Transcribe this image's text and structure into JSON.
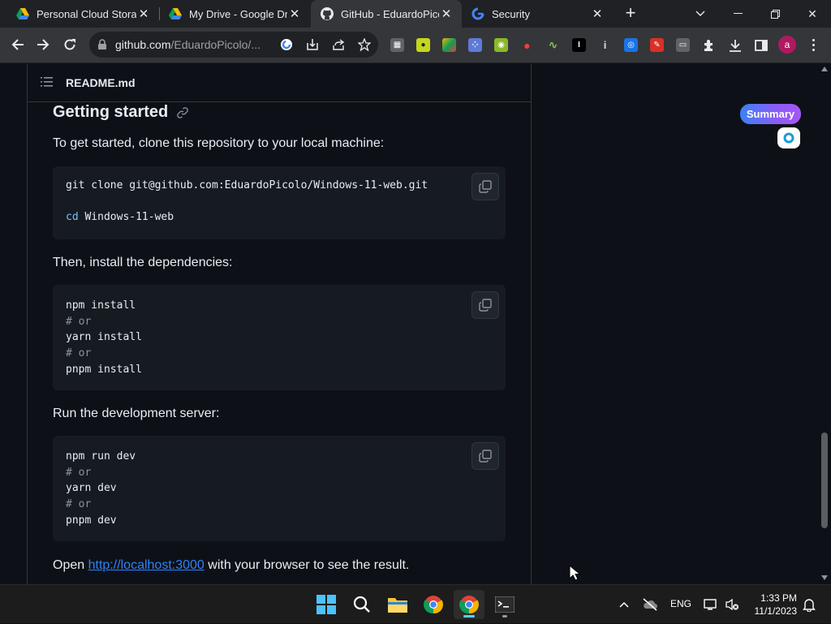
{
  "browser": {
    "tabs": [
      {
        "title": "Personal Cloud Storag",
        "favicon": "google-drive-icon",
        "active": false
      },
      {
        "title": "My Drive - Google Dri",
        "favicon": "google-drive-icon",
        "active": false
      },
      {
        "title": "GitHub - EduardoPicol",
        "favicon": "github-icon",
        "active": true
      },
      {
        "title": "Security",
        "favicon": "google-icon",
        "active": false
      }
    ],
    "url_host": "github.com",
    "url_rest": "/EduardoPicolo/..."
  },
  "readme": {
    "filename": "README.md",
    "heading": "Getting started",
    "intro": "To get started, clone this repository to your local machine:",
    "clone_block": {
      "line1": "git clone git@github.com:EduardoPicolo/Windows-11-web.git",
      "line2_kw": "cd",
      "line2_rest": " Windows-11-web"
    },
    "deps_text": "Then, install the dependencies:",
    "deps_block": [
      "npm install",
      "# or",
      "yarn install",
      "# or",
      "pnpm install"
    ],
    "dev_text": "Run the development server:",
    "dev_block": [
      "npm run dev",
      "# or",
      "yarn dev",
      "# or",
      "pnpm dev"
    ],
    "open_prefix": "Open ",
    "open_link": "http://localhost:3000",
    "open_suffix": " with your browser to see the result."
  },
  "summary_widget": {
    "label": "Summary"
  },
  "avatar_letter": "a",
  "taskbar": {
    "language": "ENG",
    "time": "1:33 PM",
    "date": "11/1/2023"
  },
  "colors": {
    "page_bg": "#0d1117",
    "code_bg": "#161b22",
    "link": "#2f81f7",
    "chrome_dark": "#202124",
    "toolbar": "#35363a"
  }
}
